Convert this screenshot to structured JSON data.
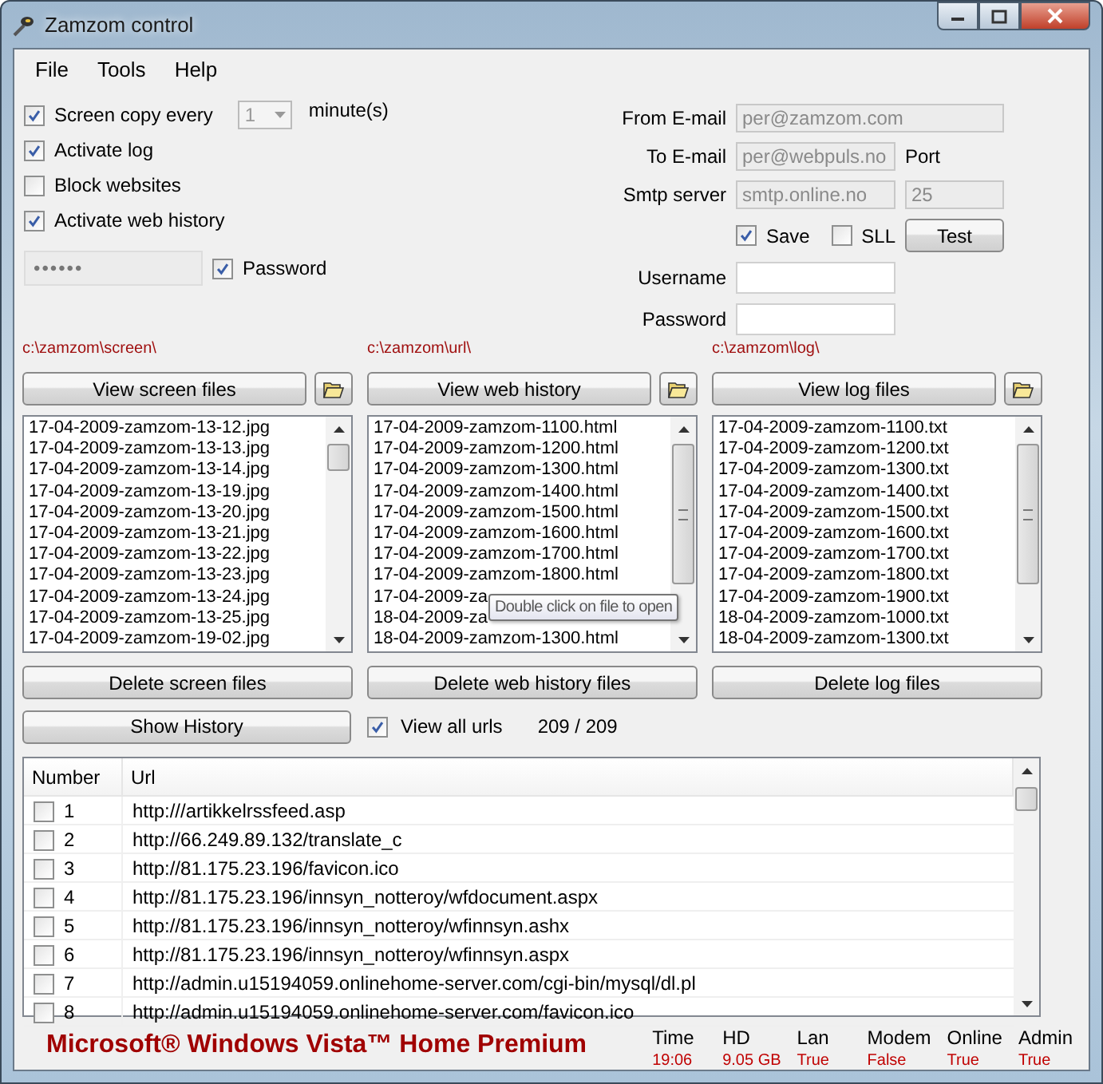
{
  "window": {
    "title": "Zamzom control"
  },
  "menu": [
    "File",
    "Tools",
    "Help"
  ],
  "screen_copy": {
    "label": "Screen copy every",
    "checked": true,
    "interval": "1",
    "unit": "minute(s)"
  },
  "options": [
    {
      "label": "Activate log",
      "checked": true
    },
    {
      "label": "Block websites",
      "checked": false
    },
    {
      "label": "Activate web history",
      "checked": true
    }
  ],
  "password": {
    "value": "••••••",
    "label": "Password",
    "checked": true
  },
  "mail": {
    "from": {
      "label": "From E-mail",
      "value": "per@zamzom.com"
    },
    "to": {
      "label": "To E-mail",
      "value": "per@webpuls.no"
    },
    "port_label": "Port",
    "smtp": {
      "label": "Smtp server",
      "value": "smtp.online.no"
    },
    "port": "25",
    "save": {
      "label": "Save",
      "checked": true
    },
    "ssl": {
      "label": "SLL",
      "checked": false
    },
    "test_button": "Test",
    "username": {
      "label": "Username"
    },
    "password": {
      "label": "Password"
    }
  },
  "file_columns": [
    {
      "path": "c:\\zamzom\\screen\\",
      "view_button": "View screen files",
      "delete_button": "Delete screen files",
      "files": [
        "17-04-2009-zamzom-13-12.jpg",
        "17-04-2009-zamzom-13-13.jpg",
        "17-04-2009-zamzom-13-14.jpg",
        "17-04-2009-zamzom-13-19.jpg",
        "17-04-2009-zamzom-13-20.jpg",
        "17-04-2009-zamzom-13-21.jpg",
        "17-04-2009-zamzom-13-22.jpg",
        "17-04-2009-zamzom-13-23.jpg",
        "17-04-2009-zamzom-13-24.jpg",
        "17-04-2009-zamzom-13-25.jpg",
        "17-04-2009-zamzom-19-02.jpg"
      ]
    },
    {
      "path": "c:\\zamzom\\url\\",
      "view_button": "View web history",
      "delete_button": "Delete web history files",
      "files": [
        "17-04-2009-zamzom-1100.html",
        "17-04-2009-zamzom-1200.html",
        "17-04-2009-zamzom-1300.html",
        "17-04-2009-zamzom-1400.html",
        "17-04-2009-zamzom-1500.html",
        "17-04-2009-zamzom-1600.html",
        "17-04-2009-zamzom-1700.html",
        "17-04-2009-zamzom-1800.html",
        "17-04-2009-za",
        "18-04-2009-za",
        "18-04-2009-zamzom-1300.html"
      ]
    },
    {
      "path": "c:\\zamzom\\log\\",
      "view_button": "View log files",
      "delete_button": "Delete log files",
      "files": [
        "17-04-2009-zamzom-1100.txt",
        "17-04-2009-zamzom-1200.txt",
        "17-04-2009-zamzom-1300.txt",
        "17-04-2009-zamzom-1400.txt",
        "17-04-2009-zamzom-1500.txt",
        "17-04-2009-zamzom-1600.txt",
        "17-04-2009-zamzom-1700.txt",
        "17-04-2009-zamzom-1800.txt",
        "17-04-2009-zamzom-1900.txt",
        "18-04-2009-zamzom-1000.txt",
        "18-04-2009-zamzom-1300.txt"
      ]
    }
  ],
  "tooltip": "Double click on file to open",
  "history": {
    "button": "Show History",
    "view_all": {
      "label": "View all urls",
      "checked": true
    },
    "count": "209 / 209"
  },
  "table": {
    "columns": [
      "Number",
      "Url"
    ],
    "rows": [
      {
        "number": "1",
        "url": "http:///artikkelrssfeed.asp",
        "checked": false
      },
      {
        "number": "2",
        "url": "http://66.249.89.132/translate_c",
        "checked": false
      },
      {
        "number": "3",
        "url": "http://81.175.23.196/favicon.ico",
        "checked": false
      },
      {
        "number": "4",
        "url": "http://81.175.23.196/innsyn_notteroy/wfdocument.aspx",
        "checked": false
      },
      {
        "number": "5",
        "url": "http://81.175.23.196/innsyn_notteroy/wfinnsyn.ashx",
        "checked": false
      },
      {
        "number": "6",
        "url": "http://81.175.23.196/innsyn_notteroy/wfinnsyn.aspx",
        "checked": false
      },
      {
        "number": "7",
        "url": "http://admin.u15194059.onlinehome-server.com/cgi-bin/mysql/dl.pl",
        "checked": false
      },
      {
        "number": "8",
        "url": "http://admin.u15194059.onlinehome-server.com/favicon.ico",
        "checked": false
      }
    ]
  },
  "footer": {
    "os": "Microsoft® Windows Vista™ Home Premium",
    "stats": [
      {
        "label": "Time",
        "value": "19:06"
      },
      {
        "label": "HD",
        "value": "9.05 GB"
      },
      {
        "label": "Lan",
        "value": "True"
      },
      {
        "label": "Modem",
        "value": "False"
      },
      {
        "label": "Online",
        "value": "True"
      },
      {
        "label": "Admin",
        "value": "True"
      }
    ]
  }
}
